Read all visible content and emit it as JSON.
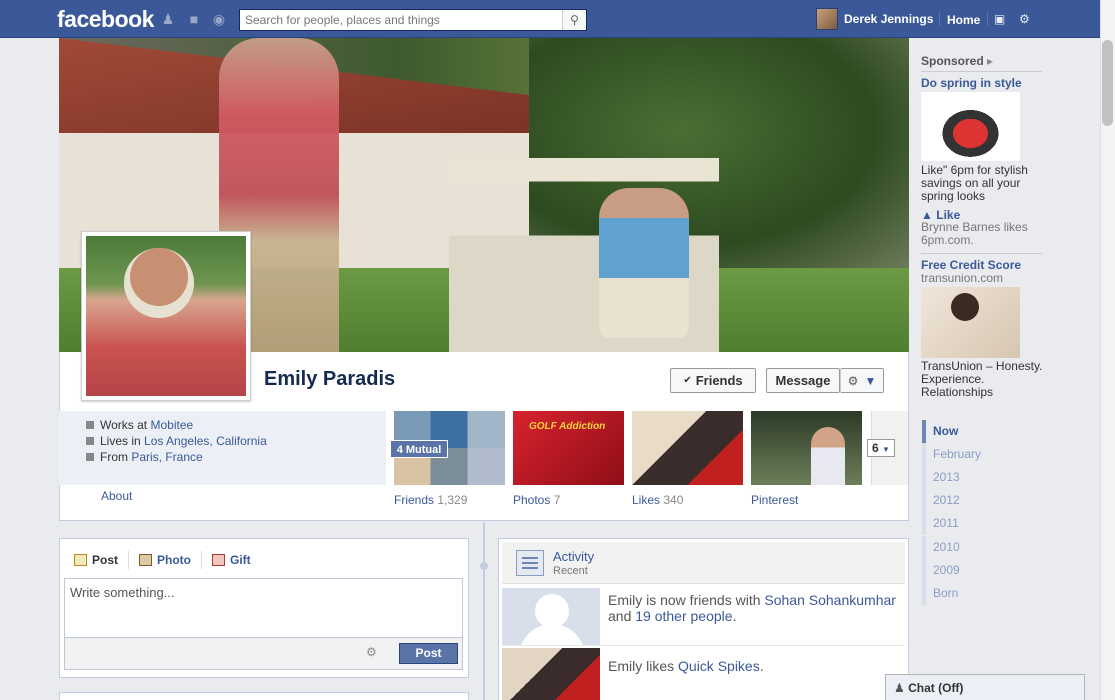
{
  "topbar": {
    "logo": "facebook",
    "search_placeholder": "Search for people, places and things",
    "user_name": "Derek Jennings",
    "home_label": "Home"
  },
  "profile": {
    "name": "Emily Paradis",
    "friends_button": "Friends",
    "message_button": "Message",
    "works_prefix": "Works at ",
    "works_place": "Mobitee",
    "lives_prefix": "Lives in ",
    "lives_place": "Los Angeles, California",
    "from_prefix": "From ",
    "from_place": "Paris, France",
    "about_label": "About"
  },
  "apps": {
    "mutual_badge": "4 Mutual",
    "friends_label": "Friends",
    "friends_count": "1,329",
    "photos_label": "Photos",
    "photos_count": "7",
    "likes_label": "Likes",
    "likes_count": "340",
    "pinterest_label": "Pinterest",
    "photos_tile_text": "GOLF Addiction",
    "more_count": "6"
  },
  "composer": {
    "tab_post": "Post",
    "tab_photo": "Photo",
    "tab_gift": "Gift",
    "placeholder": "Write something...",
    "post_button": "Post"
  },
  "activity": {
    "title": "Activity",
    "subtitle": "Recent",
    "row1_prefix": "Emily is now friends with ",
    "row1_person": "Sohan Sohankumhar",
    "row1_mid": " and ",
    "row1_others": "19 other people",
    "row1_suffix": ".",
    "row2_prefix": "Emily likes ",
    "row2_page": "Quick Spikes",
    "row2_suffix": "."
  },
  "sidebar": {
    "sponsored": "Sponsored",
    "ad1_title": "Do spring in style",
    "ad1_body": "Like\" 6pm for stylish savings on all your spring looks",
    "ad1_like": "Like",
    "ad1_social": "Brynne Barnes likes 6pm.com.",
    "ad2_title": "Free Credit Score",
    "ad2_domain": "transunion.com",
    "ad2_body": "TransUnion – Honesty. Experience. Relationships"
  },
  "years": [
    "Now",
    "February",
    "2013",
    "2012",
    "2011",
    "2010",
    "2009",
    "Born"
  ],
  "chat": {
    "label": "Chat (Off)"
  },
  "colors": {
    "brand": "#3b5998",
    "link": "#3b5998",
    "button_blue": "#5b74a8"
  }
}
